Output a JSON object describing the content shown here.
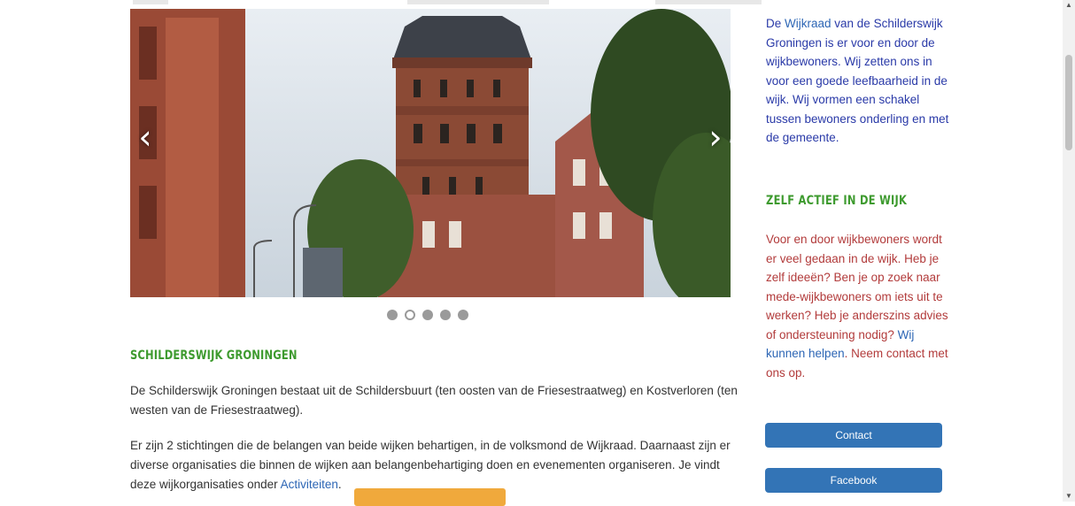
{
  "slider": {
    "prev_icon": "‹",
    "next_icon": "›",
    "dots_total": 5,
    "active_dot": 2
  },
  "main": {
    "heading": "SCHILDERSWIJK GRONINGEN",
    "p1": "De Schilderswijk Groningen bestaat uit de Schildersbuurt (ten oosten van de Friesestraatweg) en Kostverloren (ten westen van de Friesestraatweg).",
    "p2_before": "Er zijn 2 stichtingen die de belangen van beide wijken behartigen, in de volksmond de Wijkraad. Daarnaast zijn er diverse organisaties die binnen de wijken aan belangenbehartiging doen en evenementen organiseren. Je vindt deze wijkorganisaties onder ",
    "p2_link": "Activiteiten",
    "p2_after": "."
  },
  "sidebar": {
    "intro_link": "Wijkraad",
    "intro_before": "De ",
    "intro_after": " van de Schilderswijk Groningen is er voor en door de wijkbewoners. Wij zetten ons in voor een goede leefbaarheid in de wijk. Wij vormen een schakel tussen bewoners onderling en met de gemeente.",
    "heading": "ZELF ACTIEF IN DE WIJK",
    "active_before": "Voor en door wijkbewoners wordt er veel gedaan in de wijk. Heb je zelf ideeën? Ben je op zoek naar mede-wijkbewoners om iets uit te werken? Heb je anderszins advies of ondersteuning nodig? ",
    "active_link": "Wij kunnen helpen",
    "active_after": ". Neem contact met ons op.",
    "contact_label": "Contact",
    "facebook_label": "Facebook"
  },
  "colors": {
    "heading_green": "#3d9a2e",
    "link_blue": "#2d66b5",
    "button_blue": "#3374b6",
    "accent_orange": "#f0a93c",
    "text_red": "#b23b3b"
  }
}
